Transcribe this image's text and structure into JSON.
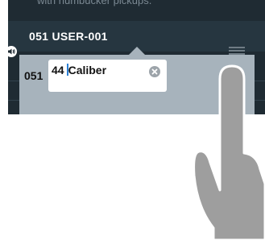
{
  "background_screen": {
    "description_text": "with humbucker pickups.",
    "patch_title": "051 USER-001"
  },
  "edit_popup": {
    "patch_number": "051",
    "name_before_caret": "44",
    "name_after_caret": "Caliber"
  },
  "icons": {
    "sound": "speaker-icon",
    "menu": "hamburger-menu-icon",
    "clear": "clear-x-icon",
    "gesture": "tap-finger-icon"
  },
  "colors": {
    "screen_bg": "#1f2b33",
    "panel_bg": "#a7b3bc",
    "caret": "#2a7fd4",
    "finger": "#9e9e9e"
  }
}
